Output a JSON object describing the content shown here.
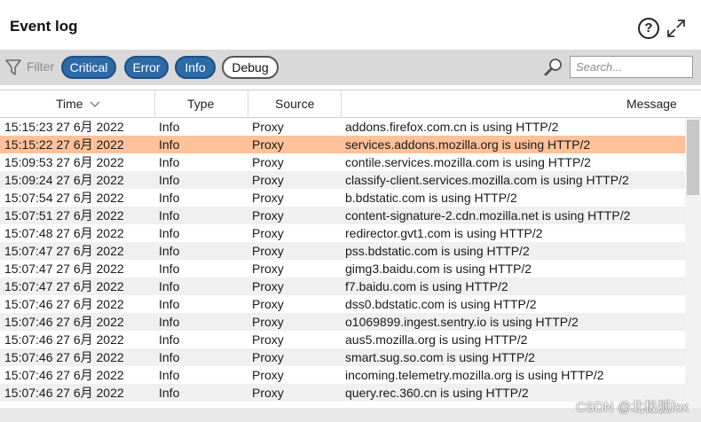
{
  "panel": {
    "title": "Event log",
    "help_glyph": "?",
    "help_icon": "help-circle-icon",
    "expand_icon": "expand-arrows-icon",
    "drag_handle_icon": "grip-dots-icon"
  },
  "toolbar": {
    "filter_label": "Filter",
    "filter_icon": "funnel-icon",
    "chips": [
      {
        "label": "Critical",
        "active": true
      },
      {
        "label": "Error",
        "active": true
      },
      {
        "label": "Info",
        "active": true
      },
      {
        "label": "Debug",
        "active": false
      }
    ],
    "search_icon": "magnifier-icon",
    "search_placeholder": "Search...",
    "search_value": ""
  },
  "table": {
    "columns": [
      {
        "label": "Time",
        "sorted": "descending"
      },
      {
        "label": "Type"
      },
      {
        "label": "Source"
      },
      {
        "label": "Message"
      }
    ],
    "selected_row": 1,
    "rows": [
      {
        "time": "15:15:23 27 6月 2022",
        "type": "Info",
        "source": "Proxy",
        "message": "addons.firefox.com.cn is using HTTP/2"
      },
      {
        "time": "15:15:22 27 6月 2022",
        "type": "Info",
        "source": "Proxy",
        "message": "services.addons.mozilla.org is using HTTP/2"
      },
      {
        "time": "15:09:53 27 6月 2022",
        "type": "Info",
        "source": "Proxy",
        "message": "contile.services.mozilla.com is using HTTP/2"
      },
      {
        "time": "15:09:24 27 6月 2022",
        "type": "Info",
        "source": "Proxy",
        "message": "classify-client.services.mozilla.com is using HTTP/2"
      },
      {
        "time": "15:07:54 27 6月 2022",
        "type": "Info",
        "source": "Proxy",
        "message": "b.bdstatic.com is using HTTP/2"
      },
      {
        "time": "15:07:51 27 6月 2022",
        "type": "Info",
        "source": "Proxy",
        "message": "content-signature-2.cdn.mozilla.net is using HTTP/2"
      },
      {
        "time": "15:07:48 27 6月 2022",
        "type": "Info",
        "source": "Proxy",
        "message": "redirector.gvt1.com is using HTTP/2"
      },
      {
        "time": "15:07:47 27 6月 2022",
        "type": "Info",
        "source": "Proxy",
        "message": "pss.bdstatic.com is using HTTP/2"
      },
      {
        "time": "15:07:47 27 6月 2022",
        "type": "Info",
        "source": "Proxy",
        "message": "gimg3.baidu.com is using HTTP/2"
      },
      {
        "time": "15:07:47 27 6月 2022",
        "type": "Info",
        "source": "Proxy",
        "message": "f7.baidu.com is using HTTP/2"
      },
      {
        "time": "15:07:46 27 6月 2022",
        "type": "Info",
        "source": "Proxy",
        "message": "dss0.bdstatic.com is using HTTP/2"
      },
      {
        "time": "15:07:46 27 6月 2022",
        "type": "Info",
        "source": "Proxy",
        "message": "o1069899.ingest.sentry.io is using HTTP/2"
      },
      {
        "time": "15:07:46 27 6月 2022",
        "type": "Info",
        "source": "Proxy",
        "message": "aus5.mozilla.org is using HTTP/2"
      },
      {
        "time": "15:07:46 27 6月 2022",
        "type": "Info",
        "source": "Proxy",
        "message": "smart.sug.so.com is using HTTP/2"
      },
      {
        "time": "15:07:46 27 6月 2022",
        "type": "Info",
        "source": "Proxy",
        "message": "incoming.telemetry.mozilla.org is using HTTP/2"
      },
      {
        "time": "15:07:46 27 6月 2022",
        "type": "Info",
        "source": "Proxy",
        "message": "query.rec.360.cn is using HTTP/2"
      }
    ]
  },
  "watermark": "CSDN @北极狐fox",
  "colors": {
    "chip_active_bg": "#2e6aa6",
    "selected_row_bg": "#fec19a",
    "toolbar_bg": "#d9d9d9",
    "alt_row_bg": "#f0f0f0"
  }
}
